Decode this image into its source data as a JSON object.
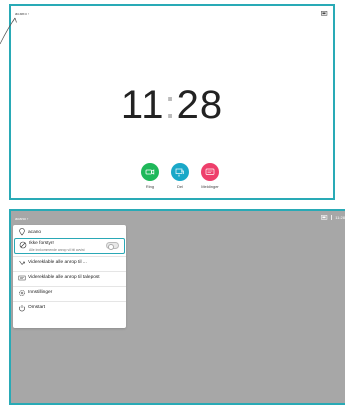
{
  "top_screen": {
    "system_name": "acano",
    "clock_hours": "11",
    "clock_sep": ":",
    "clock_minutes": "28",
    "buttons": [
      {
        "label": "Ring",
        "color": "#1fb85a"
      },
      {
        "label": "Del",
        "color": "#1aa8c8"
      },
      {
        "label": "Meldinger",
        "color": "#ee3f6b"
      }
    ]
  },
  "bottom_screen": {
    "system_name": "acano",
    "time": "11:28",
    "menu": {
      "header": "acano",
      "dnd_label": "Ikke forstyrr",
      "dnd_sub": "Alle innkommende anrop vil bli avvist",
      "dnd_on": false,
      "items": [
        "Videreklable alle anrop til ...",
        "Videreklable alle anrop til talepost",
        "Innstillinger",
        "Omstart"
      ]
    }
  },
  "colors": {
    "border": "#29aab6",
    "overlay_bg": "#a7a7a7"
  }
}
